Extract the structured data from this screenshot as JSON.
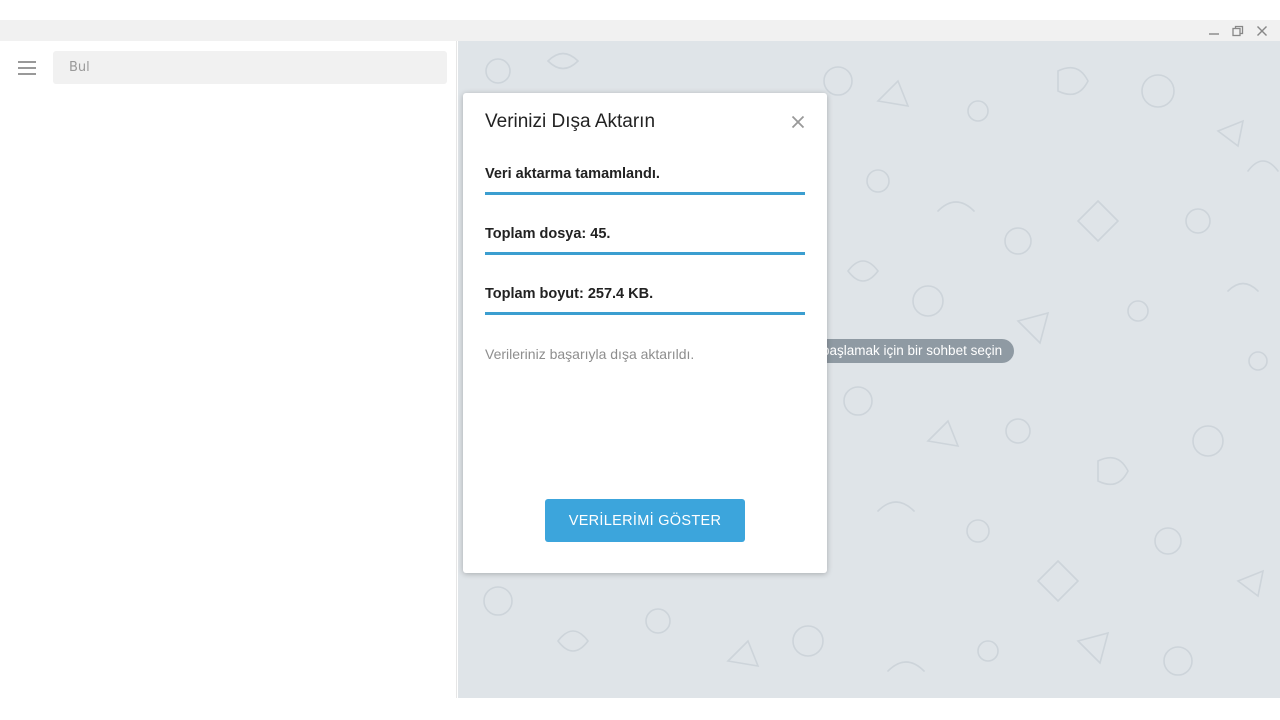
{
  "window": {
    "minimize_icon": "minimize-icon",
    "maximize_icon": "restore-icon",
    "close_icon": "close-icon"
  },
  "sidebar": {
    "menu_icon": "hamburger-menu-icon",
    "search": {
      "placeholder": "Bul",
      "value": ""
    }
  },
  "chat_area": {
    "empty_state_text": "başlamak için bir sohbet seçin"
  },
  "dialog": {
    "title": "Verinizi Dışa Aktarın",
    "close_icon": "close-icon",
    "progress_items": [
      {
        "label": "Veri aktarma tamamlandı.",
        "progress": 1.0
      },
      {
        "label": "Toplam dosya: 45.",
        "progress": 1.0
      },
      {
        "label": "Toplam boyut: 257.4 KB.",
        "progress": 1.0
      }
    ],
    "status_text": "Verileriniz başarıyla dışa aktarıldı.",
    "action_button_label": "VERİLERİMİ GÖSTER"
  },
  "colors": {
    "accent": "#3ca5dc",
    "progress": "#3b9ed0",
    "chat_background": "#dfe4e8",
    "empty_pill": "#8f9aa3"
  }
}
